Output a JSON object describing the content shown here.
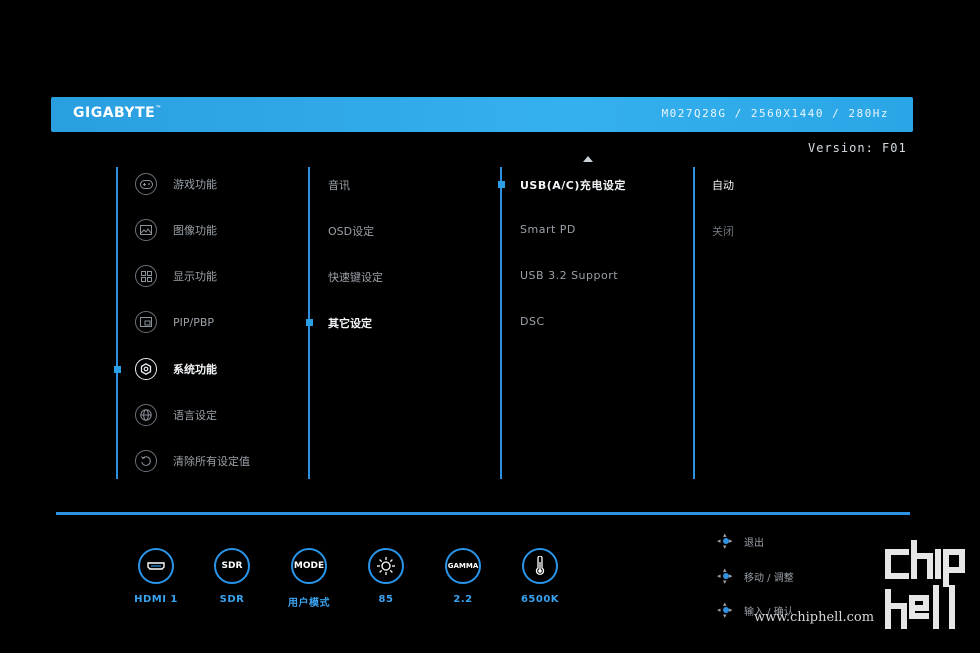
{
  "header": {
    "brand": "GIGABYTE",
    "brand_tm": "™",
    "model_info": "M027Q28G / 2560X1440 / 280Hz"
  },
  "version": "Version: F01",
  "menu_main": [
    {
      "label": "游戏功能",
      "icon": "gamepad-icon"
    },
    {
      "label": "图像功能",
      "icon": "picture-icon"
    },
    {
      "label": "显示功能",
      "icon": "display-grid-icon"
    },
    {
      "label": "PIP/PBP",
      "icon": "pip-icon"
    },
    {
      "label": "系统功能",
      "icon": "gear-icon",
      "active": true
    },
    {
      "label": "语言设定",
      "icon": "globe-icon"
    },
    {
      "label": "清除所有设定值",
      "icon": "reset-icon"
    }
  ],
  "menu_sub": [
    {
      "label": "音讯"
    },
    {
      "label": "OSD设定"
    },
    {
      "label": "快速键设定"
    },
    {
      "label": "其它设定",
      "active": true
    }
  ],
  "menu_sub2": [
    {
      "label": "USB(A/C)充电设定",
      "active": true
    },
    {
      "label": "Smart PD"
    },
    {
      "label": "USB 3.2 Support"
    },
    {
      "label": "DSC"
    }
  ],
  "menu_options": [
    {
      "label": "自动",
      "active": true
    },
    {
      "label": "关闭"
    }
  ],
  "status": [
    {
      "icon_text": "",
      "label": "HDMI 1",
      "icon": "hdmi-port-icon"
    },
    {
      "icon_text": "SDR",
      "label": "SDR",
      "icon": "sdr-icon"
    },
    {
      "icon_text": "MODE",
      "label": "用户模式",
      "icon": "mode-icon"
    },
    {
      "icon_text": "",
      "label": "85",
      "icon": "brightness-sun-icon"
    },
    {
      "icon_text": "GAMMA",
      "label": "2.2",
      "icon": "gamma-icon"
    },
    {
      "icon_text": "",
      "label": "6500K",
      "icon": "thermometer-icon"
    }
  ],
  "hints": [
    {
      "label": "退出"
    },
    {
      "label": "移动 / 调整"
    },
    {
      "label": "输入 / 确认"
    }
  ],
  "watermark": {
    "text": "www.chiphell.com",
    "logo": "chip hell"
  },
  "colors": {
    "accent": "#2f93e4",
    "header": "#35b0ee",
    "background": "#000000"
  }
}
